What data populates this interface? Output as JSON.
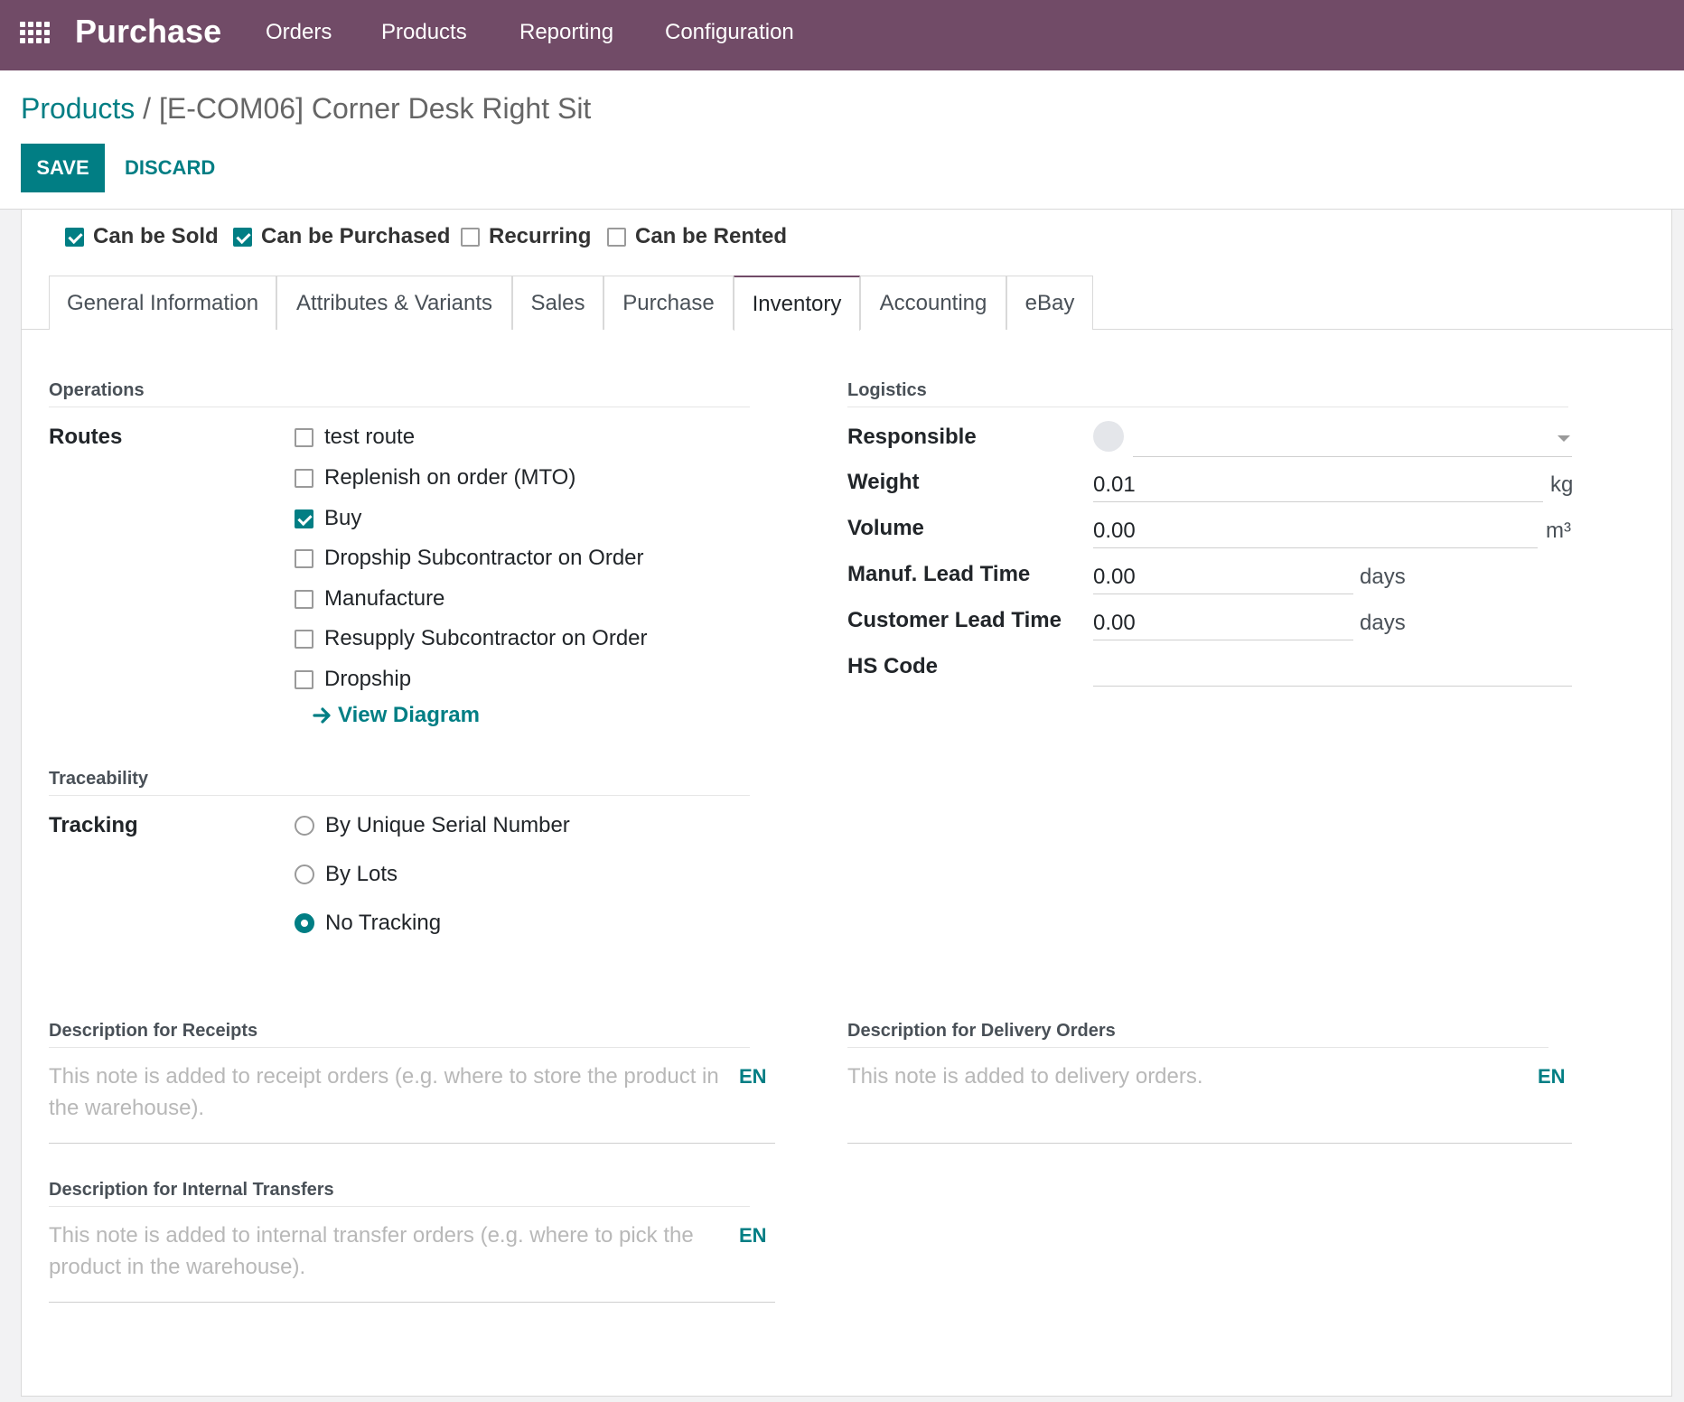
{
  "navbar": {
    "app_name": "Purchase",
    "menu": [
      "Orders",
      "Products",
      "Reporting",
      "Configuration"
    ]
  },
  "breadcrumb": {
    "parent": "Products",
    "separator": "/",
    "current": "[E-COM06] Corner Desk Right Sit"
  },
  "actions": {
    "save": "SAVE",
    "discard": "DISCARD"
  },
  "product_flags": [
    {
      "label": "Can be Sold",
      "checked": true
    },
    {
      "label": "Can be Purchased",
      "checked": true
    },
    {
      "label": "Recurring",
      "checked": false
    },
    {
      "label": "Can be Rented",
      "checked": false
    }
  ],
  "tabs": [
    {
      "label": "General Information",
      "active": false
    },
    {
      "label": "Attributes & Variants",
      "active": false
    },
    {
      "label": "Sales",
      "active": false
    },
    {
      "label": "Purchase",
      "active": false
    },
    {
      "label": "Inventory",
      "active": true
    },
    {
      "label": "Accounting",
      "active": false
    },
    {
      "label": "eBay",
      "active": false
    }
  ],
  "operations": {
    "title": "Operations",
    "routes_label": "Routes",
    "routes": [
      {
        "label": "test route",
        "checked": false
      },
      {
        "label": "Replenish on order (MTO)",
        "checked": false
      },
      {
        "label": "Buy",
        "checked": true
      },
      {
        "label": "Dropship Subcontractor on Order",
        "checked": false
      },
      {
        "label": "Manufacture",
        "checked": false
      },
      {
        "label": "Resupply Subcontractor on Order",
        "checked": false
      },
      {
        "label": "Dropship",
        "checked": false
      }
    ],
    "view_diagram": "View Diagram"
  },
  "traceability": {
    "title": "Traceability",
    "tracking_label": "Tracking",
    "options": [
      {
        "label": "By Unique Serial Number",
        "selected": false
      },
      {
        "label": "By Lots",
        "selected": false
      },
      {
        "label": "No Tracking",
        "selected": true
      }
    ]
  },
  "logistics": {
    "title": "Logistics",
    "responsible_label": "Responsible",
    "responsible_value": "",
    "weight_label": "Weight",
    "weight_value": "0.01",
    "weight_unit": "kg",
    "volume_label": "Volume",
    "volume_value": "0.00",
    "volume_unit": "m³",
    "manuf_label": "Manuf. Lead Time",
    "manuf_value": "0.00",
    "manuf_unit": "days",
    "customer_label": "Customer Lead Time",
    "customer_value": "0.00",
    "customer_unit": "days",
    "hs_label": "HS Code",
    "hs_value": ""
  },
  "descriptions": {
    "receipts": {
      "title": "Description for Receipts",
      "placeholder_line1": "This note is added to receipt orders (e.g. where to store the product in",
      "placeholder_line2": "the warehouse).",
      "lang": "EN"
    },
    "delivery": {
      "title": "Description for Delivery Orders",
      "placeholder_line1": "This note is added to delivery orders.",
      "lang": "EN"
    },
    "internal": {
      "title": "Description for Internal Transfers",
      "placeholder_line1": "This note is added to internal transfer orders (e.g. where to pick the",
      "placeholder_line2": "product in the warehouse).",
      "lang": "EN"
    }
  },
  "colors": {
    "navbar": "#714b67",
    "primary": "#017e84"
  }
}
